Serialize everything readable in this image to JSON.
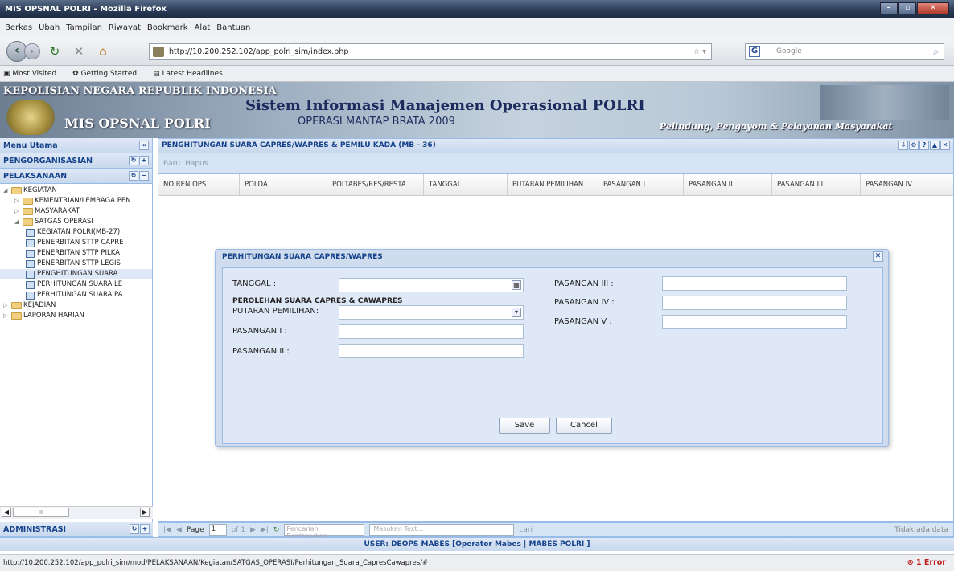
{
  "window": {
    "title": "MIS OPSNAL POLRI - Mozilla Firefox"
  },
  "menubar": [
    "Berkas",
    "Ubah",
    "Tampilan",
    "Riwayat",
    "Bookmark",
    "Alat",
    "Bantuan"
  ],
  "navbar": {
    "url": "http://10.200.252.102/app_polri_sim/index.php",
    "search_placeholder": "Google"
  },
  "bookmarks": [
    "Most Visited",
    "Getting Started",
    "Latest Headlines"
  ],
  "banner": {
    "org": "KEPOLISIAN NEGARA REPUBLIK INDONESIA",
    "app": "MIS OPSNAL POLRI",
    "system": "Sistem Informasi Manajemen Operasional POLRI",
    "operation": "OPERASI MANTAP BRATA 2009",
    "motto": "Pelindung, Pengayom & Pelayanan Masyarakat"
  },
  "sidebar": {
    "title": "Menu Utama",
    "pengorganisasian": "PENGORGANISASIAN",
    "pelaksanaan": "PELAKSANAAN",
    "administrasi": "ADMINISTRASI",
    "tree": [
      {
        "label": "KEGIATAN",
        "type": "folder",
        "level": 0,
        "open": true
      },
      {
        "label": "KEMENTRIAN/LEMBAGA PEN",
        "type": "folder",
        "level": 1
      },
      {
        "label": "MASYARAKAT",
        "type": "folder",
        "level": 1
      },
      {
        "label": "SATGAS OPERASI",
        "type": "folder",
        "level": 1,
        "open": true
      },
      {
        "label": "KEGIATAN POLRI(MB-27)",
        "type": "leaf",
        "level": 2
      },
      {
        "label": "PENERBITAN STTP CAPRE",
        "type": "leaf",
        "level": 2
      },
      {
        "label": "PENERBITAN STTP PILKA",
        "type": "leaf",
        "level": 2
      },
      {
        "label": "PENERBITAN STTP LEGIS",
        "type": "leaf",
        "level": 2
      },
      {
        "label": "PENGHITUNGAN SUARA",
        "type": "leaf",
        "level": 2,
        "selected": true
      },
      {
        "label": "PERHITUNGAN SUARA LE",
        "type": "leaf",
        "level": 2
      },
      {
        "label": "PERHITUNGAN SUARA PA",
        "type": "leaf",
        "level": 2
      },
      {
        "label": "KEJADIAN",
        "type": "folder",
        "level": 0
      },
      {
        "label": "LAPORAN HARIAN",
        "type": "folder",
        "level": 0
      }
    ],
    "scroll_label": "III"
  },
  "main": {
    "title": "PENGHITUNGAN SUARA CAPRES/WAPRES & PEMILU KADA (MB - 36)",
    "toolbar": [
      "Baru",
      "Hapus"
    ],
    "columns": [
      "NO REN OPS",
      "POLDA",
      "POLTABES/RES/RESTA",
      "TANGGAL",
      "PUTARAN PEMILIHAN",
      "PASANGAN I",
      "PASANGAN II",
      "PASANGAN III",
      "PASANGAN IV"
    ]
  },
  "pager": {
    "page_label": "Page",
    "page_value": "1",
    "of_label": "of 1",
    "search_by": "Pencarian Berdasarkan...",
    "text_placeholder": "Masukan Text...",
    "find": "cari",
    "empty": "Tidak ada data"
  },
  "footer": "USER: DEOPS MABES [Operator Mabes | MABES POLRI ]",
  "status": {
    "url": "http://10.200.252.102/app_polri_sim/mod/PELAKSANAAN/Kegiatan/SATGAS_OPERASI/Perhitungan_Suara_CapresCawapres/#",
    "error": "1 Error"
  },
  "dialog": {
    "title": "PERHITUNGAN SUARA CAPRES/WAPRES",
    "tanggal": "TANGGAL :",
    "section": "PEROLEHAN SUARA CAPRES & CAWAPRES",
    "putaran": "PUTARAN PEMILIHAN:",
    "pasangan1": "PASANGAN I :",
    "pasangan2": "PASANGAN II :",
    "pasangan3": "PASANGAN III :",
    "pasangan4": "PASANGAN IV :",
    "pasangan5": "PASANGAN V :",
    "save": "Save",
    "cancel": "Cancel"
  }
}
